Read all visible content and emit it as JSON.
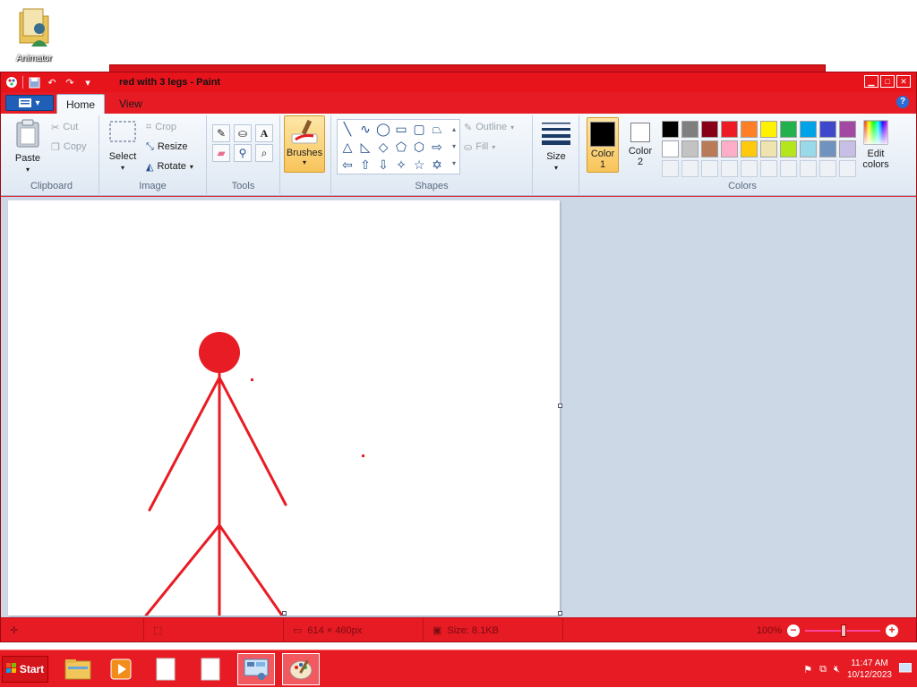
{
  "desktop": {
    "icons": [
      {
        "label": "Animator",
        "icon": "folder-user-icon"
      }
    ]
  },
  "window": {
    "title": "red with 3 legs - Paint",
    "controls": [
      "minimize-icon",
      "maximize-icon",
      "close-icon"
    ]
  },
  "quick_access": [
    "save-icon",
    "undo-icon",
    "redo-icon",
    "customize-icon"
  ],
  "tabs": [
    {
      "label": "Home",
      "active": true
    },
    {
      "label": "View",
      "active": false
    }
  ],
  "ribbon": {
    "clipboard": {
      "label": "Clipboard",
      "paste": "Paste",
      "cut": "Cut",
      "copy": "Copy"
    },
    "image": {
      "label": "Image",
      "select": "Select",
      "crop": "Crop",
      "resize": "Resize",
      "rotate": "Rotate"
    },
    "tools": {
      "label": "Tools",
      "items": [
        "pencil-icon",
        "fill-icon",
        "text-icon",
        "eraser-icon",
        "color-picker-icon",
        "magnifier-icon"
      ]
    },
    "brushes": {
      "label": "Brushes"
    },
    "shapes": {
      "label": "Shapes",
      "outline": "Outline",
      "fill": "Fill",
      "items": [
        "╲",
        "∿",
        "◯",
        "▭",
        "▢",
        "⏢",
        "△",
        "◺",
        "◇",
        "⬠",
        "⬡",
        "⇨",
        "⇦",
        "⇧",
        "⇩",
        "✧",
        "☆",
        "✡"
      ]
    },
    "size": {
      "label": "Size"
    },
    "colors": {
      "label": "Colors",
      "color1_label": "Color\n1",
      "color1_line1": "Color",
      "color1_line2": "1",
      "color1_value": "#000000",
      "color2_line1": "Color",
      "color2_line2": "2",
      "color2_value": "#ffffff",
      "edit_line1": "Edit",
      "edit_line2": "colors",
      "palette_row1": [
        "#000000",
        "#7f7f7f",
        "#880015",
        "#ed1c24",
        "#ff7f27",
        "#fff200",
        "#22b14c",
        "#00a2e8",
        "#3f48cc",
        "#a349a4"
      ],
      "palette_row2": [
        "#ffffff",
        "#c3c3c3",
        "#b97a57",
        "#ffaec9",
        "#ffc90e",
        "#efe4b0",
        "#b5e61d",
        "#99d9ea",
        "#7092be",
        "#c8bfe7"
      ]
    }
  },
  "drawing": {
    "stroke_color": "#e81c24"
  },
  "status": {
    "dimensions": "614 × 460px",
    "size": "Size: 8.1KB",
    "zoom": "100%"
  },
  "taskbar": {
    "start": "Start",
    "items": [
      "file-explorer-icon",
      "media-player-icon",
      "document-icon",
      "document-icon",
      "control-panel-icon",
      "paint-icon"
    ],
    "time": "11:47 AM",
    "date": "10/12/2023",
    "tray": [
      "flag-icon",
      "network-icon",
      "volume-muted-icon",
      "show-desktop-icon"
    ]
  }
}
